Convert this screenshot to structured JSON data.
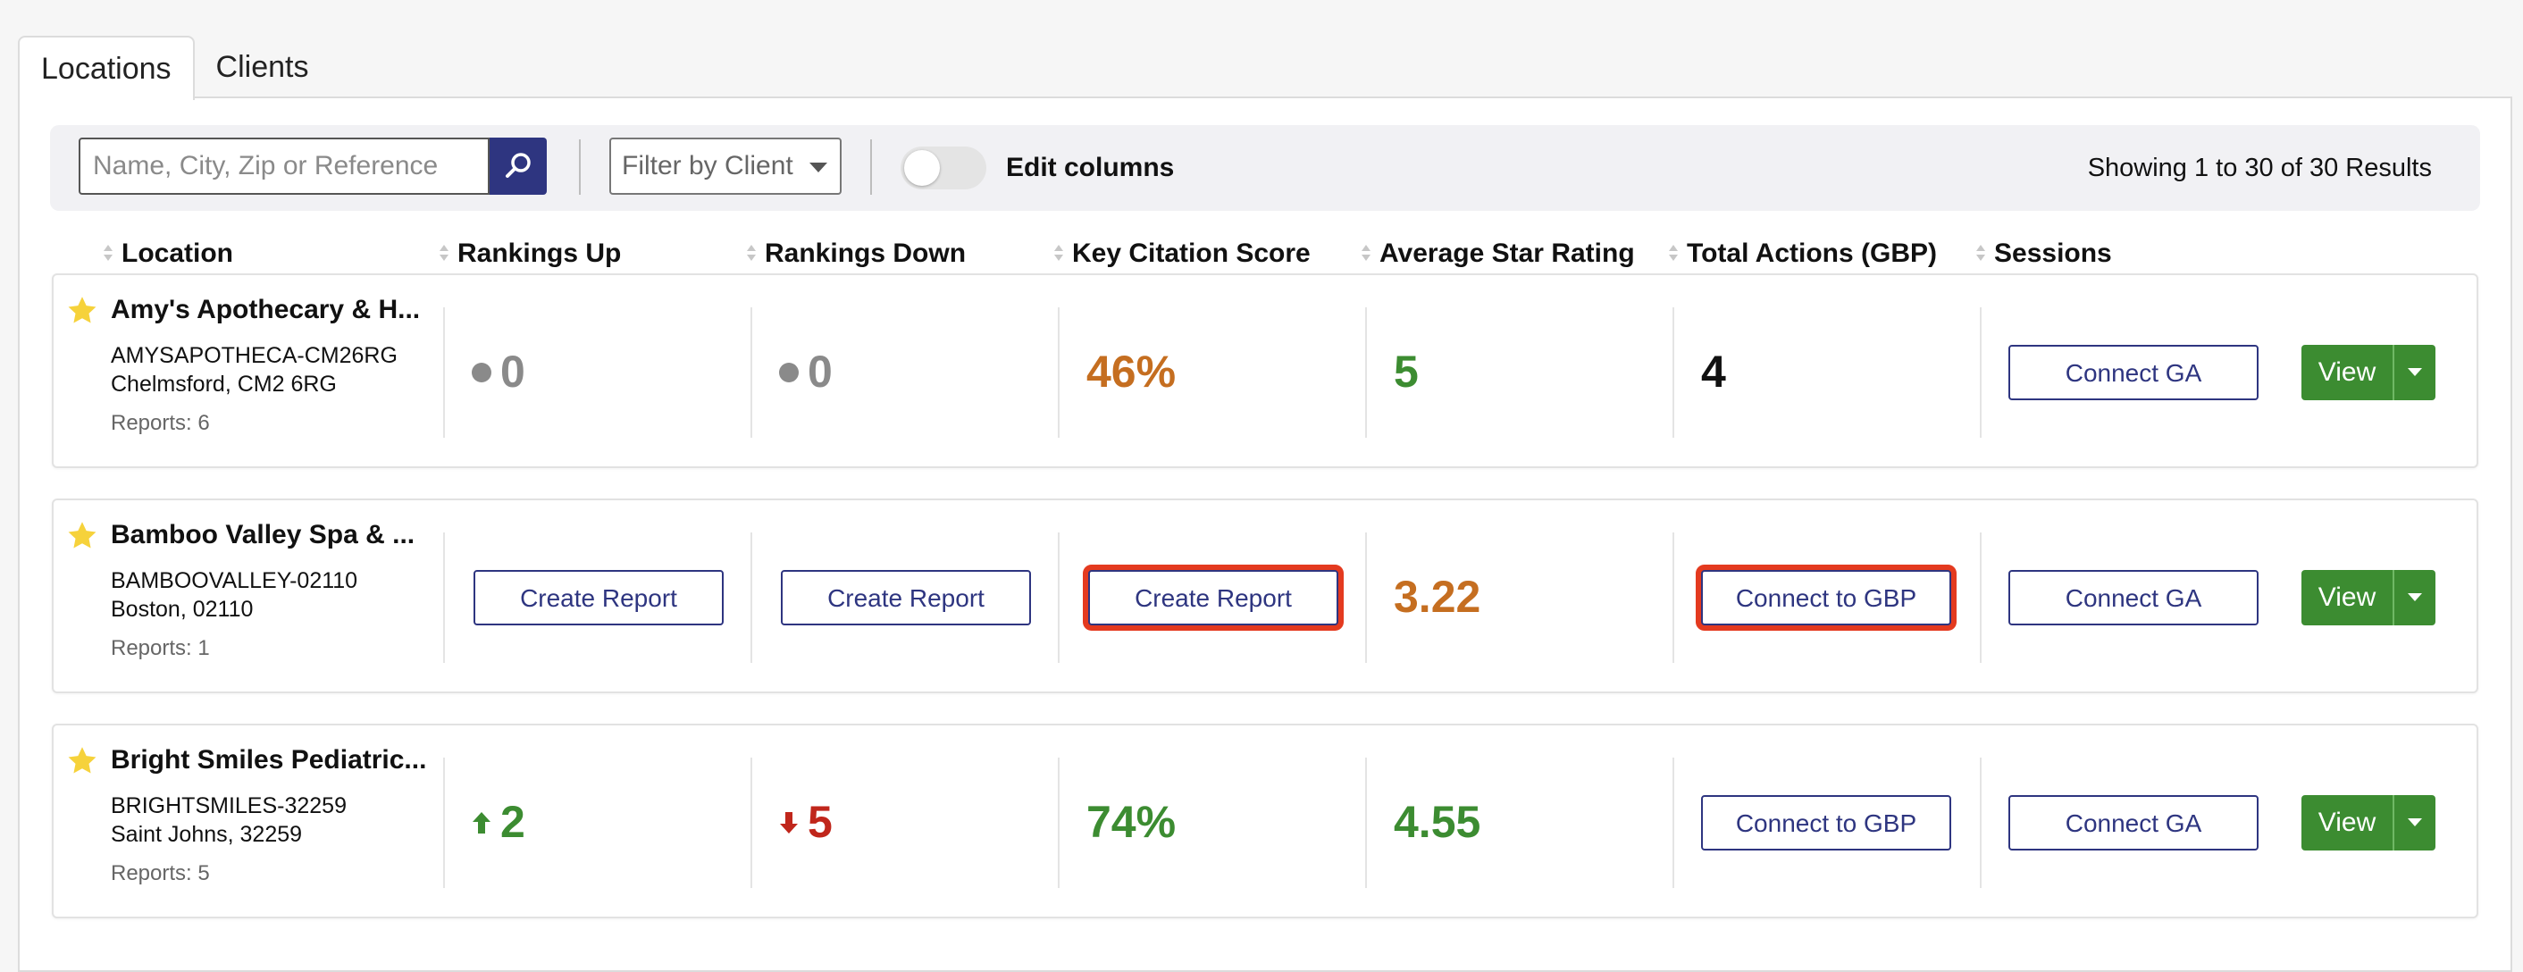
{
  "tabs": [
    {
      "label": "Locations",
      "active": true
    },
    {
      "label": "Clients",
      "active": false
    }
  ],
  "toolbar": {
    "search_placeholder": "Name, City, Zip or Reference",
    "client_filter": "Filter by Client",
    "edit_columns_label": "Edit columns",
    "edit_columns_on": false,
    "results_text": "Showing 1 to 30 of 30 Results"
  },
  "columns": [
    "Location",
    "Rankings Up",
    "Rankings Down",
    "Key Citation Score",
    "Average Star Rating",
    "Total Actions (GBP)",
    "Sessions"
  ],
  "colors": {
    "accent": "#2e3580",
    "green": "#3c8c31",
    "orange": "#c56e20",
    "red": "#c0261b",
    "grey": "#8a8a8a",
    "highlight": "#e43a1f"
  },
  "rows": [
    {
      "name": "Amy's Apothecary & H...",
      "reference": "AMYSAPOTHECA-CM26RG",
      "city": "Chelmsford, CM2 6RG",
      "reports": "Reports: 6",
      "rankings_up": "0",
      "rankings_down": "0",
      "citation": "46%",
      "star": "5",
      "actions": "4",
      "sessions_btn": "Connect GA",
      "view_label": "View"
    },
    {
      "name": "Bamboo Valley Spa & ...",
      "reference": "BAMBOOVALLEY-02110",
      "city": "Boston, 02110",
      "reports": "Reports: 1",
      "rankings_up_btn": "Create Report",
      "rankings_down_btn": "Create Report",
      "citation_btn": "Create Report",
      "star": "3.22",
      "actions_btn": "Connect to GBP",
      "sessions_btn": "Connect GA",
      "view_label": "View"
    },
    {
      "name": "Bright Smiles Pediatric...",
      "reference": "BRIGHTSMILES-32259",
      "city": "Saint Johns, 32259",
      "reports": "Reports: 5",
      "rankings_up": "2",
      "rankings_down": "5",
      "citation": "74%",
      "star": "4.55",
      "actions_btn": "Connect to GBP",
      "sessions_btn": "Connect GA",
      "view_label": "View"
    }
  ]
}
